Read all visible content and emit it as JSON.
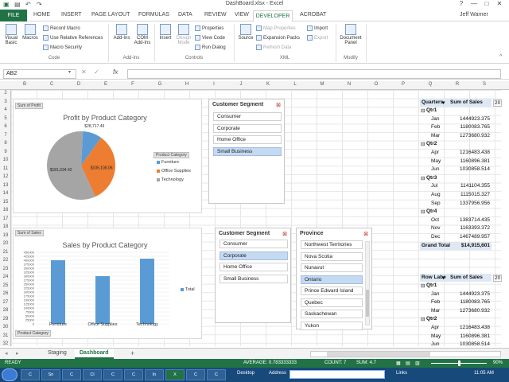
{
  "title_bar": {
    "title": "DashBoard.xlsx - Excel",
    "qa_icons": [
      "excel-icon",
      "save-icon",
      "undo-icon",
      "redo-icon"
    ],
    "window_controls": [
      "?",
      "—",
      "□",
      "✕"
    ]
  },
  "ribbon_tabs": {
    "file": "FILE",
    "items": [
      "HOME",
      "INSERT",
      "PAGE LAYOUT",
      "FORMULAS",
      "DATA",
      "REVIEW",
      "VIEW"
    ],
    "active": "DEVELOPER",
    "acrobat": "ACROBAT",
    "user": "Jeff Warner"
  },
  "ribbon": {
    "visual_basic": "Visual Basic",
    "macros": "Macros",
    "record_macro": "Record Macro",
    "relative_refs": "Use Relative References",
    "macro_security": "Macro Security",
    "code_group": "Code",
    "add_ins": "Add-Ins",
    "com_add_ins": "COM Add-Ins",
    "addins_group": "Add-Ins",
    "insert": "Insert",
    "design_mode": "Design Mode",
    "properties": "Properties",
    "view_code": "View Code",
    "run_dialog": "Run Dialog",
    "controls_group": "Controls",
    "source": "Source",
    "map_properties": "Map Properties",
    "expansion_packs": "Expansion Packs",
    "refresh_data": "Refresh Data",
    "import": "Import",
    "export": "Export",
    "xml_group": "XML",
    "document_panel": "Document Panel",
    "modify_group": "Modify"
  },
  "formula_bar": {
    "name_box": "AB2",
    "fx": "fx",
    "value": ""
  },
  "columns": [
    "B",
    "C",
    "D",
    "E",
    "F",
    "G",
    "H",
    "I",
    "J",
    "K",
    "L",
    "M",
    "N",
    "O",
    "P",
    "Q",
    "R",
    "S"
  ],
  "rows": [
    "2",
    "3",
    "4",
    "5",
    "6",
    "7",
    "8",
    "9",
    "10",
    "11",
    "12",
    "13",
    "14",
    "15",
    "16",
    "17",
    "18",
    "19",
    "20",
    "21",
    "22",
    "23",
    "24",
    "25",
    "26",
    "27",
    "28",
    "29",
    "30",
    "31",
    "32"
  ],
  "pivot_quarters": {
    "header_label": "Quarters",
    "header_value": "Sum of Sales",
    "extra": "20",
    "rows": [
      {
        "label": "Qtr1",
        "value": "",
        "type": "group"
      },
      {
        "label": "Jan",
        "value": "1444923.375",
        "type": "item"
      },
      {
        "label": "Feb",
        "value": "1180083.765",
        "type": "item"
      },
      {
        "label": "Mar",
        "value": "1273680.932",
        "type": "item"
      },
      {
        "label": "Qtr2",
        "value": "",
        "type": "group"
      },
      {
        "label": "Apr",
        "value": "1216483.438",
        "type": "item"
      },
      {
        "label": "May",
        "value": "1160896.381",
        "type": "item"
      },
      {
        "label": "Jun",
        "value": "1030858.514",
        "type": "item"
      },
      {
        "label": "Qtr3",
        "value": "",
        "type": "group"
      },
      {
        "label": "Jul",
        "value": "1141104.355",
        "type": "item"
      },
      {
        "label": "Aug",
        "value": "1115015.327",
        "type": "item"
      },
      {
        "label": "Sep",
        "value": "1337956.956",
        "type": "item"
      },
      {
        "label": "Qtr4",
        "value": "",
        "type": "group"
      },
      {
        "label": "Oct",
        "value": "1383714.435",
        "type": "item"
      },
      {
        "label": "Nov",
        "value": "1163393.372",
        "type": "item"
      },
      {
        "label": "Dec",
        "value": "1467489.957",
        "type": "item"
      },
      {
        "label": "Grand Total",
        "value": "$14,915,601",
        "type": "total"
      }
    ]
  },
  "pivot_rows": {
    "header_label": "Row Labe",
    "header_value": "Sum of Sales",
    "extra": "20",
    "rows": [
      {
        "label": "Qtr1",
        "value": "",
        "type": "group"
      },
      {
        "label": "Jan",
        "value": "1444923.375",
        "type": "item"
      },
      {
        "label": "Feb",
        "value": "1180083.765",
        "type": "item"
      },
      {
        "label": "Mar",
        "value": "1273680.932",
        "type": "item"
      },
      {
        "label": "Qtr2",
        "value": "",
        "type": "group"
      },
      {
        "label": "Apr",
        "value": "1216483.438",
        "type": "item"
      },
      {
        "label": "May",
        "value": "1160896.381",
        "type": "item"
      },
      {
        "label": "Jun",
        "value": "1030858.514",
        "type": "item"
      }
    ]
  },
  "chart_data": [
    {
      "type": "pie",
      "title": "Profit by Product Category",
      "field_button": "Sum of Profit",
      "axis_button": "Product Category",
      "categories": [
        "Furniture",
        "Office Supplies",
        "Technology"
      ],
      "values": [
        28717.49,
        105108.06,
        181634.42
      ],
      "data_labels": [
        "$28,717.49",
        "$105,108.06",
        "$181,634.42"
      ],
      "colors": [
        "#5b9bd5",
        "#ed7d31",
        "#a5a5a5"
      ],
      "legend": "right"
    },
    {
      "type": "bar",
      "title": "Sales by Product Category",
      "field_button": "Sum of Sales",
      "axis_button": "Product Category",
      "categories": [
        "Furniture",
        "Office Supplies",
        "Technology"
      ],
      "series": [
        {
          "name": "Total",
          "values": [
            400000,
            300000,
            410000
          ]
        }
      ],
      "ylim": [
        0,
        450000
      ],
      "yticks": [
        "0",
        "25000",
        "50000",
        "75000",
        "100000",
        "125000",
        "150000",
        "175000",
        "200000",
        "225000",
        "250000",
        "275000",
        "300000",
        "325000",
        "350000",
        "375000",
        "400000",
        "425000",
        "450000"
      ],
      "color": "#5b9bd5",
      "legend": "right"
    }
  ],
  "slicer_segment_1": {
    "title": "Customer Segment",
    "items": [
      "Consumer",
      "Corporate",
      "Home Office",
      "Small Business"
    ],
    "selected": "Small Business"
  },
  "slicer_segment_2": {
    "title": "Customer Segment",
    "items": [
      "Consumer",
      "Corporate",
      "Home Office",
      "Small Business"
    ],
    "selected": "Corporate"
  },
  "slicer_province": {
    "title": "Province",
    "items": [
      "Northwest Territories",
      "Nova Scotia",
      "Nunavut",
      "Ontario",
      "Prince Edward Island",
      "Quebec",
      "Saskachewan",
      "Yukon"
    ],
    "selected": "Ontario"
  },
  "sheet_tabs": {
    "items": [
      "Staging",
      "Dashboard"
    ],
    "active": "Dashboard",
    "add": "+"
  },
  "status_bar": {
    "ready": "READY",
    "average": "AVERAGE: 0.783333333",
    "count": "COUNT: 7",
    "sum": "SUM: 4.7",
    "zoom": "90%"
  },
  "taskbar": {
    "desktop": "Desktop",
    "address": "Address",
    "links": "Links",
    "time": "11:05 AM"
  }
}
